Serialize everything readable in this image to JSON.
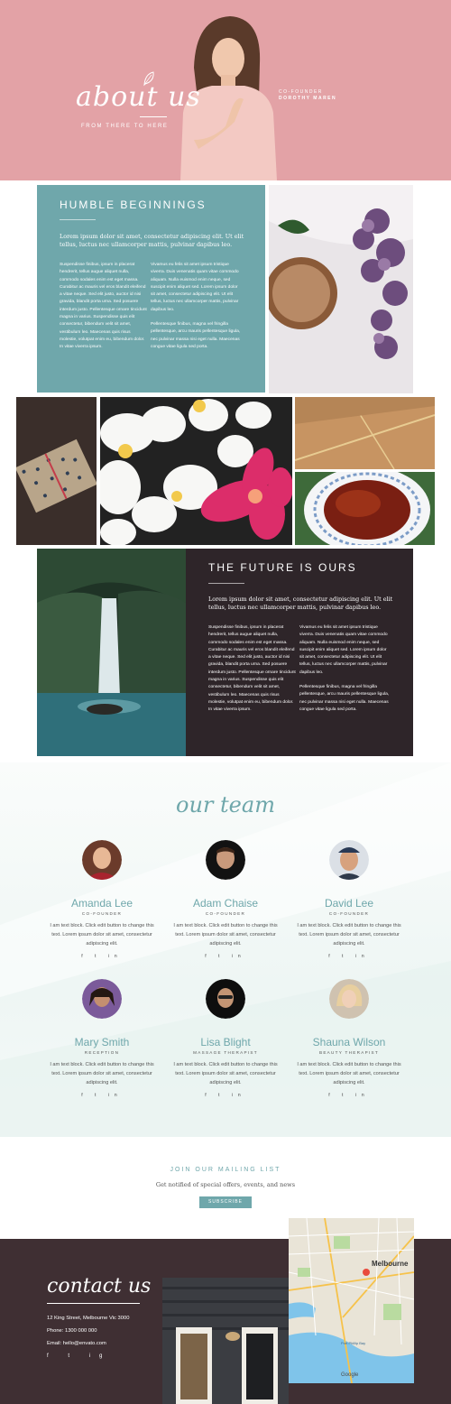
{
  "hero": {
    "title": "about us",
    "subtitle": "FROM THERE TO HERE",
    "role_line1": "CO-FOUNDER",
    "role_line2": "DOROTHY MAREN"
  },
  "section1": {
    "title": "HUMBLE BEGINNINGS",
    "lead": "Lorem ipsum dolor sit amet, consectetur adipiscing elit. Ut elit tellus, luctus nec ullamcorper mattis, pulvinar dapibus leo.",
    "col1": "Suspendisse finibus, ipsum in placerat hendrerit, tellus augue aliquet nulla, commodo sodales enim est eget massa. Curabitur ac mauris vel eros blandit eleifend a vitae neque. Sed elit justo, auctor id nisi gravida, blandit porta urna. Sed posuere interdum justo. Pellentesque ornare tincidunt magna in varius. Suspendisse quis elit consectetur, bibendum velit sit amet, vestibulum leo. Maecenas quis risus molestie, volutpat enim eu, bibendum dolor. In vitae viverra ipsum.",
    "col2a": "Vivamus eu felis sit amet ipsum tristique viverra. Duis venenatis quam vitae commodo aliquam. Nulla euismod enim neque, sed suscipit enim aliquet sed. Lorem ipsum dolor sit amet, consectetur adipiscing elit. Ut elit tellus, luctus nec ullamcorper mattis, pulvinar dapibus leo.",
    "col2b": "Pellentesque finibus, magna vel fringilla pellentesque, arcu mauris pellentesque ligula, nec pulvinar massa nisi eget nulla. Maecenas congue vitae ligula sed porta."
  },
  "section3": {
    "title": "THE FUTURE IS OURS",
    "lead": "Lorem ipsum dolor sit amet, consectetur adipiscing elit. Ut elit tellus, luctus nec ullamcorper mattis, pulvinar dapibus leo.",
    "col1": "Suspendisse finibus, ipsum in placerat hendrerit, tellus augue aliquet nulla, commodo sodales enim est eget massa. Curabitur ac mauris vel eros blandit eleifend a vitae neque. Sed elit justo, auctor id nisi gravida, blandit porta urna. Sed posuere interdum justo. Pellentesque ornare tincidunt magna in varius. Suspendisse quis elit consectetur, bibendum velit sit amet, vestibulum leo. Maecenas quis risus molestie, volutpat enim eu, bibendum dolor. In vitae viverra ipsum.",
    "col2a": "Vivamus eu felis sit amet ipsum tristique viverra. Duis venenatis quam vitae commodo aliquam. Nulla euismod enim neque, sed suscipit enim aliquet sed. Lorem ipsum dolor sit amet, consectetur adipiscing elit. Ut elit tellus, luctus nec ullamcorper mattis, pulvinar dapibus leo.",
    "col2b": "Pellentesque finibus, magna vel fringilla pellentesque, arcu mauris pellentesque ligula, nec pulvinar massa nisi eget nulla. Maecenas congue vitae ligula sed porta."
  },
  "team": {
    "title": "our team",
    "members": [
      {
        "name": "Amanda Lee",
        "role": "CO-FOUNDER",
        "text": "I am text block. Click edit button to change this text. Lorem ipsum dolor sit amet, consectetur adipiscing elit.",
        "social": "f  t  in"
      },
      {
        "name": "Adam Chaise",
        "role": "CO-FOUNDER",
        "text": "I am text block. Click edit button to change this text. Lorem ipsum dolor sit amet, consectetur adipiscing elit.",
        "social": "f  t  in"
      },
      {
        "name": "David Lee",
        "role": "CO-FOUNDER",
        "text": "I am text block. Click edit button to change this text. Lorem ipsum dolor sit amet, consectetur adipiscing elit.",
        "social": "f  t  in"
      },
      {
        "name": "Mary Smith",
        "role": "RECEPTION",
        "text": "I am text block. Click edit button to change this text. Lorem ipsum dolor sit amet, consectetur adipiscing elit.",
        "social": "f  t  in"
      },
      {
        "name": "Lisa Blight",
        "role": "MASSAGE THERAPIST",
        "text": "I am text block. Click edit button to change this text. Lorem ipsum dolor sit amet, consectetur adipiscing elit.",
        "social": "f  t  in"
      },
      {
        "name": "Shauna Wilson",
        "role": "BEAUTY THERAPIST",
        "text": "I am text block. Click edit button to change this text. Lorem ipsum dolor sit amet, consectetur adipiscing elit.",
        "social": "f  t  in"
      }
    ]
  },
  "mailing": {
    "title": "JOIN OUR MAILING LIST",
    "subtitle": "Get notified of special offers, events, and news",
    "button": "SUBSCRIBE"
  },
  "contact": {
    "title": "contact us",
    "address": "12 King Street, Melbourne Vic 3000",
    "phone": "Phone: 1300 000 000",
    "email": "Email: hello@envato.com",
    "social": "f  t  ig"
  },
  "map": {
    "city": "Melbourne",
    "label2": "Port Phillip Bay",
    "attribution": "Google"
  },
  "colors": {
    "hero_pink": "#e3a2a6",
    "teal": "#6fa7ab",
    "dark": "#2e2529",
    "contact_bg": "#3f2f33"
  }
}
